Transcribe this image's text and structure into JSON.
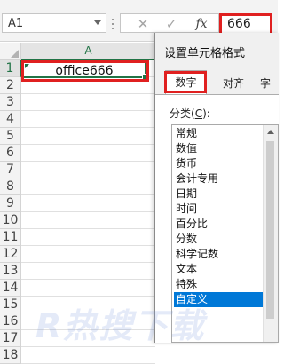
{
  "formula_bar": {
    "name_box": "A1",
    "cancel_symbol": "✕",
    "enter_symbol": "✓",
    "fx_symbol": "fx",
    "formula_value": "666"
  },
  "sheet": {
    "column_header": "A",
    "rows": [
      "1",
      "2",
      "3",
      "4",
      "5",
      "6",
      "7",
      "8",
      "9",
      "10",
      "11",
      "12",
      "13",
      "14",
      "15",
      "16",
      "17",
      "18"
    ],
    "cell_a1": "office666"
  },
  "dialog": {
    "title": "设置单元格格式",
    "tabs": [
      {
        "label": "数字",
        "active": true
      },
      {
        "label": "对齐",
        "active": false
      },
      {
        "label": "字",
        "active": false
      }
    ],
    "category_label": "分类(",
    "category_label_key": "C",
    "category_label_end": "):",
    "categories": [
      {
        "label": "常规",
        "selected": false
      },
      {
        "label": "数值",
        "selected": false
      },
      {
        "label": "货币",
        "selected": false
      },
      {
        "label": "会计专用",
        "selected": false
      },
      {
        "label": "日期",
        "selected": false
      },
      {
        "label": "时间",
        "selected": false
      },
      {
        "label": "百分比",
        "selected": false
      },
      {
        "label": "分数",
        "selected": false
      },
      {
        "label": "科学记数",
        "selected": false
      },
      {
        "label": "文本",
        "selected": false
      },
      {
        "label": "特殊",
        "selected": false
      },
      {
        "label": "自定义",
        "selected": true
      }
    ]
  },
  "watermark": "R热搜下载",
  "colors": {
    "accent_green": "#217346",
    "highlight_red": "#e02020",
    "selection_blue": "#0078d7"
  }
}
